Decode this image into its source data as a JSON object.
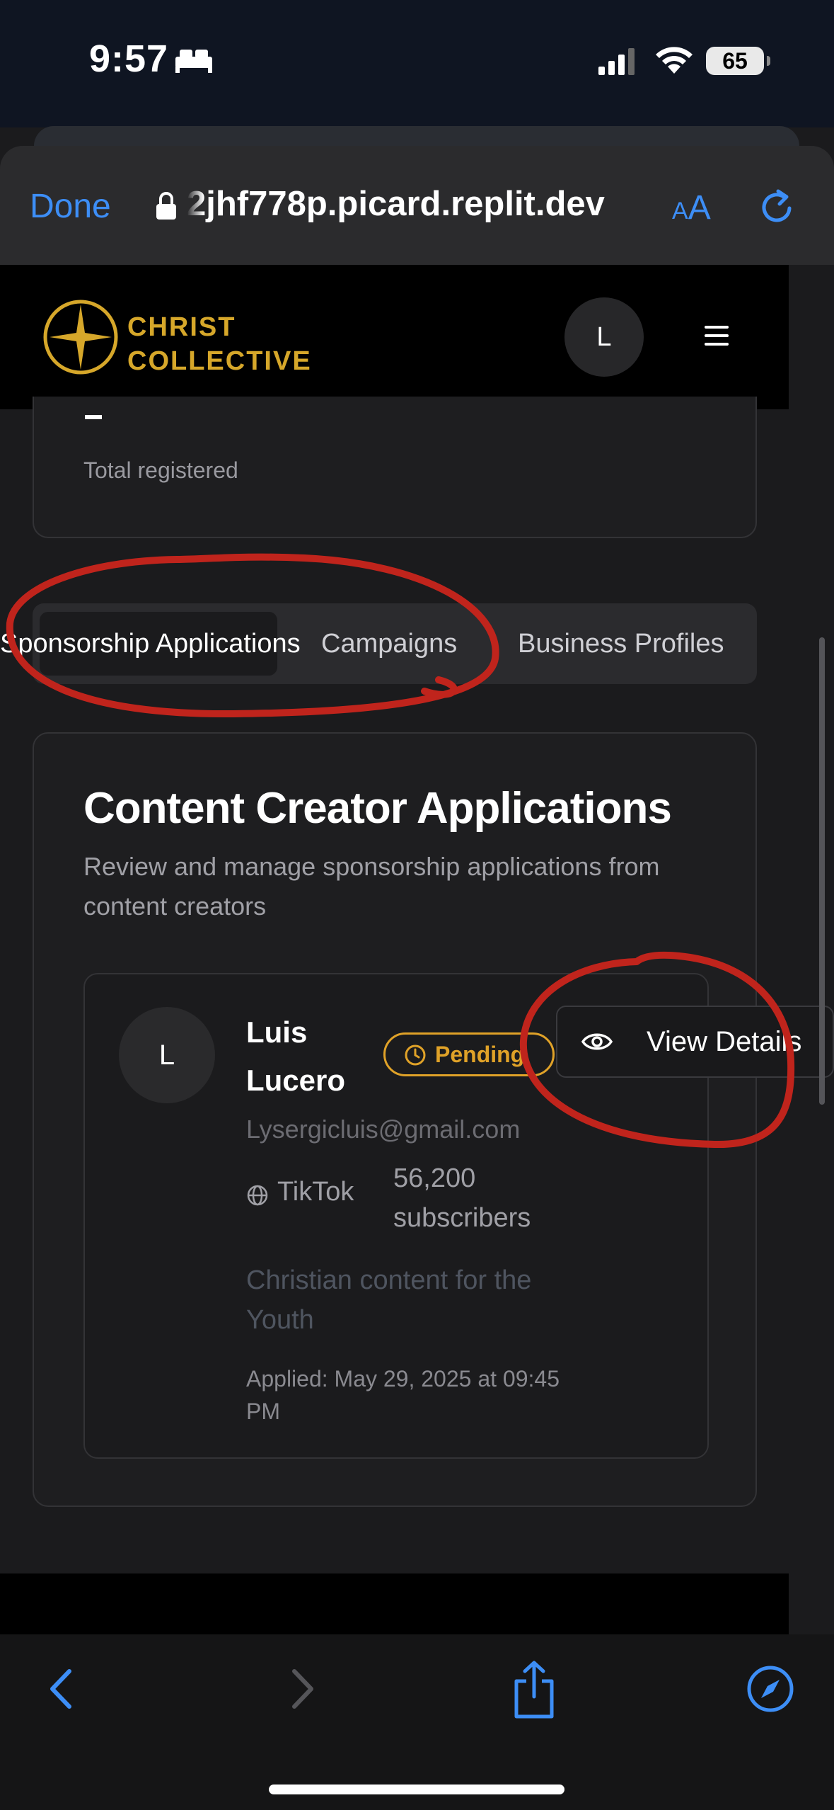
{
  "status_bar": {
    "time": "9:57",
    "battery": "65"
  },
  "browser": {
    "done_label": "Done",
    "url": "2jhf778p.picard.replit.dev",
    "text_size_label_small": "A",
    "text_size_label_large": "A"
  },
  "site_header": {
    "brand_line1": "CHRIST",
    "brand_line2": "COLLECTIVE",
    "avatar_initial": "L",
    "accent_color": "#d6a72a"
  },
  "stat_card": {
    "value": "-",
    "label": "Total registered"
  },
  "tabs": [
    {
      "label": "Sponsorship Applications",
      "active": true
    },
    {
      "label": "Campaigns",
      "active": false
    },
    {
      "label": "Business Profiles",
      "active": false
    }
  ],
  "panel": {
    "title": "Content Creator Applications",
    "subtitle": "Review and manage sponsorship applications from content creators"
  },
  "application": {
    "avatar_initial": "L",
    "name": "Luis Lucero",
    "status": "Pending",
    "status_color": "#e0a228",
    "email": "Lysergicluis@gmail.com",
    "platform": "TikTok",
    "subscribers": "56,200 subscribers",
    "description": "Christian content for the Youth",
    "applied": "Applied: May 29, 2025 at 09:45 PM",
    "view_button": "View Details"
  },
  "toolbar_icons": [
    "back-icon",
    "forward-icon",
    "share-icon",
    "compass-icon"
  ]
}
